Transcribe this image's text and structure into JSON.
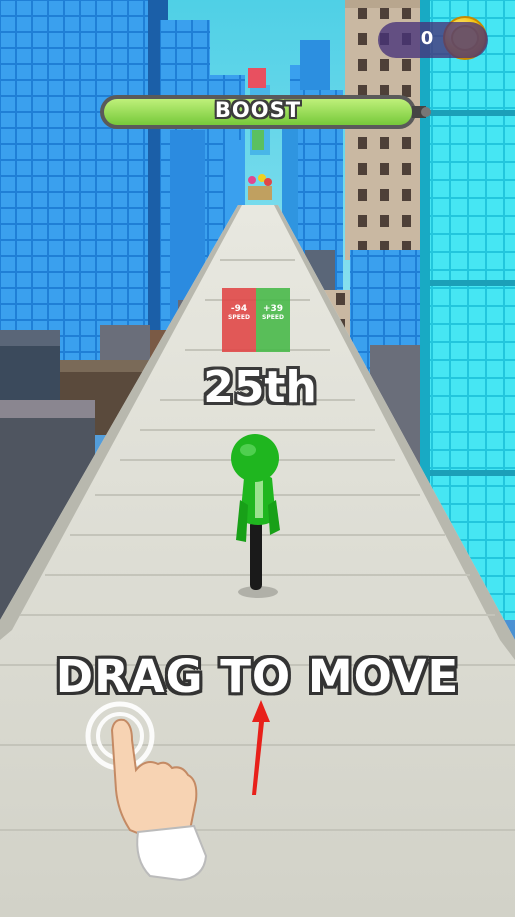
{
  "hud": {
    "coin_count": "0",
    "boost_label": "BOOST",
    "rank": "25th"
  },
  "gates": [
    {
      "value": "-94",
      "stat": "SPEED",
      "color": "#e04848"
    },
    {
      "value": "+39",
      "stat": "SPEED",
      "color": "#49b94a"
    }
  ],
  "tutorial": {
    "instruction": "DRAG TO MOVE"
  },
  "icons": {
    "coin": "coin-icon",
    "hand": "pointing-hand-icon",
    "arrow": "red-arrow-icon"
  },
  "colors": {
    "player": "#1fb61f",
    "boost_fill": "#8cd94a",
    "coin": "#f4c20d",
    "arrow": "#e8201a",
    "road": "#d9d9d0"
  }
}
